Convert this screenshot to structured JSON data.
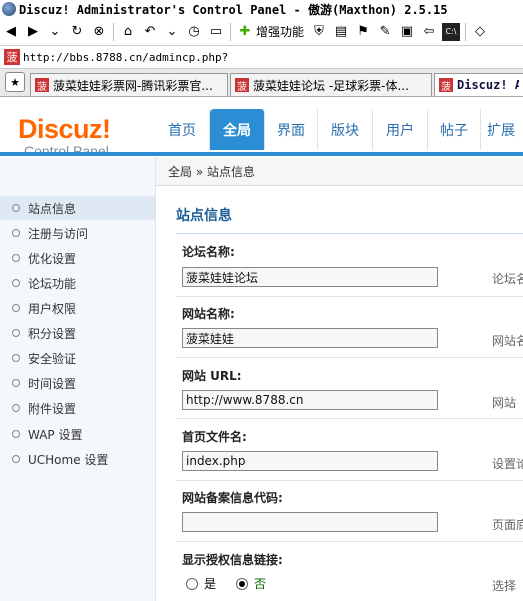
{
  "window": {
    "title": "Discuz! Administrator's Control Panel - 傲游(Maxthon) 2.5.15"
  },
  "toolbar": {
    "enhance_label": "增强功能"
  },
  "address_bar": {
    "url": "http://bbs.8788.cn/admincp.php?"
  },
  "tabs": [
    {
      "label": "菠菜娃娃彩票网-腾讯彩票官..."
    },
    {
      "label": "菠菜娃娃论坛 -足球彩票-体..."
    },
    {
      "label": "Discuz! Ad"
    }
  ],
  "logo": {
    "main": "Discuz!",
    "sub": "Control Panel"
  },
  "nav": [
    {
      "label": "首页"
    },
    {
      "label": "全局"
    },
    {
      "label": "界面"
    },
    {
      "label": "版块"
    },
    {
      "label": "用户"
    },
    {
      "label": "帖子"
    },
    {
      "label": "扩展"
    }
  ],
  "sidebar": {
    "items": [
      {
        "label": "站点信息"
      },
      {
        "label": "注册与访问"
      },
      {
        "label": "优化设置"
      },
      {
        "label": "论坛功能"
      },
      {
        "label": "用户权限"
      },
      {
        "label": "积分设置"
      },
      {
        "label": "安全验证"
      },
      {
        "label": "时间设置"
      },
      {
        "label": "附件设置"
      },
      {
        "label": "WAP 设置"
      },
      {
        "label": "UCHome 设置"
      }
    ]
  },
  "breadcrumb": "全局 » 站点信息",
  "section_title": "站点信息",
  "fields": [
    {
      "label": "论坛名称:",
      "value": "菠菜娃娃论坛",
      "note": "论坛名"
    },
    {
      "label": "网站名称:",
      "value": "菠菜娃娃",
      "note": "网站名"
    },
    {
      "label": "网站  URL:",
      "value": "http://www.8788.cn",
      "note": "网站"
    },
    {
      "label": "首页文件名:",
      "value": "index.php",
      "note": "设置论"
    },
    {
      "label": "网站备案信息代码:",
      "value": "",
      "note": "页面底"
    },
    {
      "label": "显示授权信息链接:",
      "note": "选择"
    }
  ],
  "radio": {
    "yes": "是",
    "no": "否",
    "selected": "no"
  },
  "colors": {
    "accent": "#2b8ed4",
    "logo": "#ff6600",
    "title": "#1d5f98"
  }
}
